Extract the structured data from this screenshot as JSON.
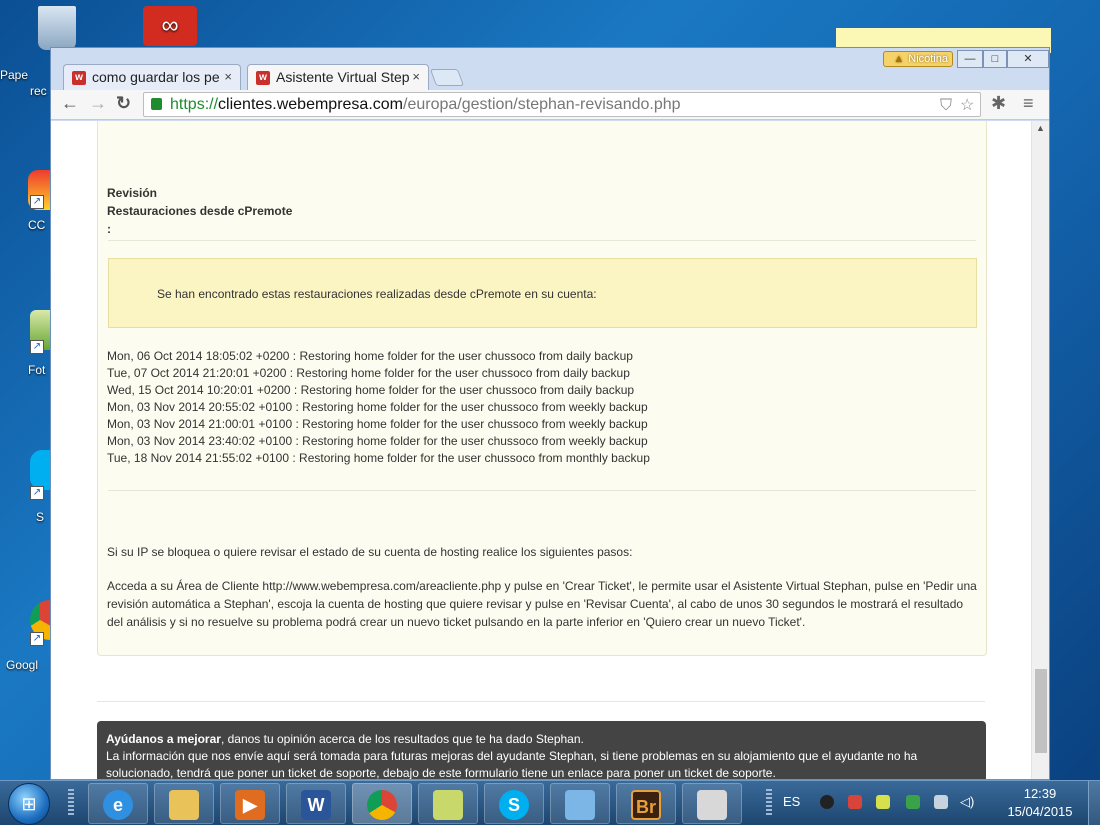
{
  "desktop": {
    "icons": [
      {
        "name": "recycle-bin",
        "label": "Pape\nrec"
      },
      {
        "name": "adobe-cc",
        "label": ""
      },
      {
        "name": "ccleaner",
        "label": "CC"
      },
      {
        "name": "fotos",
        "label": "Fot"
      },
      {
        "name": "skype",
        "label": "S"
      },
      {
        "name": "google-chrome",
        "label": "Googl"
      }
    ]
  },
  "browser": {
    "profile_name": "Nicotina",
    "tabs": [
      {
        "label": "como guardar los pe",
        "active": false
      },
      {
        "label": "Asistente Virtual Step",
        "active": true
      }
    ],
    "tab_close": "×",
    "url": {
      "scheme": "https://",
      "host": "clientes.webempresa.com",
      "path": "/europa/gestion/stephan-revisando.php"
    }
  },
  "page": {
    "section_title_1": "Revisión",
    "section_title_2": "Restauraciones desde cPremote",
    "section_colon": ":",
    "notice": "Se han encontrado estas restauraciones realizadas desde cPremote en su cuenta:",
    "log": [
      "Mon, 06 Oct 2014 18:05:02 +0200 : Restoring home folder for the user chussoco from daily backup",
      "Tue, 07 Oct 2014 21:20:01 +0200 : Restoring home folder for the user chussoco from daily backup",
      "Wed, 15 Oct 2014 10:20:01 +0200 : Restoring home folder for the user chussoco from daily backup",
      "Mon, 03 Nov 2014 20:55:02 +0100 : Restoring home folder for the user chussoco from weekly backup",
      "Mon, 03 Nov 2014 21:00:01 +0100 : Restoring home folder for the user chussoco from weekly backup",
      "Mon, 03 Nov 2014 23:40:02 +0100 : Restoring home folder for the user chussoco from weekly backup",
      "Tue, 18 Nov 2014 21:55:02 +0100 : Restoring home folder for the user chussoco from monthly backup"
    ],
    "ip_intro": "Si su IP se bloquea o quiere revisar el estado de su cuenta de hosting realice los siguientes pasos:",
    "instructions": "Acceda a su Área de Cliente http://www.webempresa.com/areacliente.php y pulse en 'Crear Ticket', le permite usar el Asistente Virtual Stephan, pulse en 'Pedir una revisión automática a Stephan', escoja la cuenta de hosting que quiere revisar y pulse en 'Revisar Cuenta', al cabo de unos 30 segundos le mostrará el resultado del análisis y si no resuelve su problema podrá crear un nuevo ticket pulsando en la parte inferior en 'Quiero crear un nuevo Ticket'.",
    "feedback_bold": "Ayúdanos a mejorar",
    "feedback_rest": ", danos tu opinión acerca de los resultados que te ha dado Stephan.",
    "feedback_body": "La información que nos envíe aquí será tomada para futuras mejoras del ayudante Stephan, si tiene problemas en su alojamiento que el ayudante no ha solucionado, tendrá que poner un ticket de soporte, debajo de este formulario tiene un enlace para poner un ticket de soporte."
  },
  "taskbar": {
    "apps": [
      {
        "name": "internet-explorer",
        "glyph": "e",
        "color": "#2f8fe0"
      },
      {
        "name": "file-explorer",
        "glyph": "",
        "color": "#e9c35a"
      },
      {
        "name": "media-player",
        "glyph": "▶",
        "color": "#e06d1f"
      },
      {
        "name": "word",
        "glyph": "W",
        "color": "#2a5699"
      },
      {
        "name": "chrome",
        "glyph": "",
        "color": "#d44638"
      },
      {
        "name": "sticky-notes",
        "glyph": "",
        "color": "#c9d86a"
      },
      {
        "name": "skype",
        "glyph": "S",
        "color": "#00aff0"
      },
      {
        "name": "notepad",
        "glyph": "",
        "color": "#7bb6e6"
      },
      {
        "name": "bridge",
        "glyph": "Br",
        "color": "#3b2210"
      },
      {
        "name": "paint",
        "glyph": "",
        "color": "#d8d8d8"
      }
    ],
    "language": "ES",
    "time": "12:39",
    "date": "15/04/2015"
  }
}
